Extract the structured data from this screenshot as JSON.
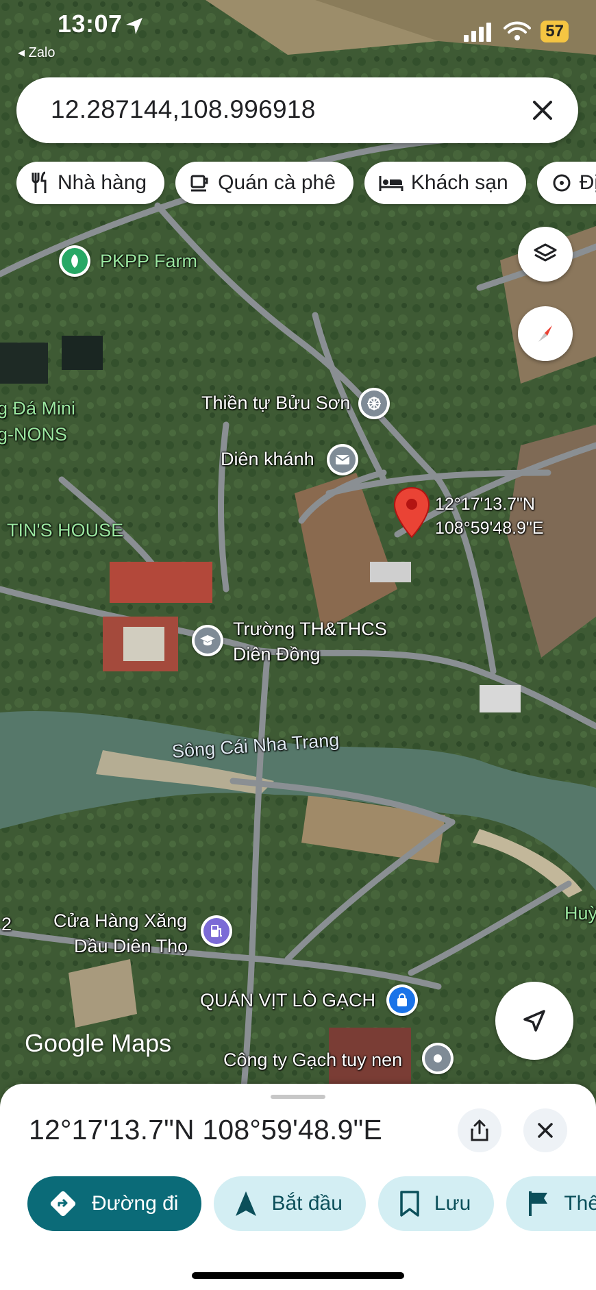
{
  "status_bar": {
    "time": "13:07",
    "back_app": "◂ Zalo",
    "battery": "57"
  },
  "search": {
    "query": "12.287144,108.996918"
  },
  "chips": [
    {
      "label": "Nhà hàng",
      "icon": "restaurant-icon"
    },
    {
      "label": "Quán cà phê",
      "icon": "coffee-icon"
    },
    {
      "label": "Khách sạn",
      "icon": "hotel-icon"
    },
    {
      "label": "Đị",
      "icon": "attraction-icon"
    }
  ],
  "map": {
    "labels": {
      "pkpp": "PKPP Farm",
      "da_mini": "g Đá Mini",
      "nons": "g-NONS",
      "tins": "TIN'S HOUSE",
      "thien_tu": "Thiền tự Bửu Sơn",
      "dien_khanh": "Diên khánh",
      "truong_1": "Trường TH&THCS",
      "truong_2": "Diên Đồng",
      "song": "Sông Cái Nha Trang",
      "cua_hang_1": "Cửa Hàng Xăng",
      "cua_hang_2": "Dầu Diên Thọ",
      "quan_vit": "QUÁN VỊT LÒ GẠCH",
      "cong_ty": "Công ty Gạch tuy nen",
      "huy": "Huỳ",
      "edge_2": "2",
      "pin_lat": "12°17'13.7\"N",
      "pin_lon": "108°59'48.9\"E"
    },
    "logo": "Google Maps"
  },
  "sheet": {
    "coords": "12°17'13.7\"N 108°59'48.9\"E",
    "actions": [
      {
        "label": "Đường đi",
        "icon": "directions-icon"
      },
      {
        "label": "Bắt đầu",
        "icon": "navigation-arrow-icon"
      },
      {
        "label": "Lưu",
        "icon": "bookmark-icon"
      },
      {
        "label": "Thê",
        "icon": "flag-icon"
      }
    ]
  },
  "colors": {
    "primary": "#0b6b78",
    "secondary": "#d3eef3",
    "pin": "#ea4335"
  }
}
